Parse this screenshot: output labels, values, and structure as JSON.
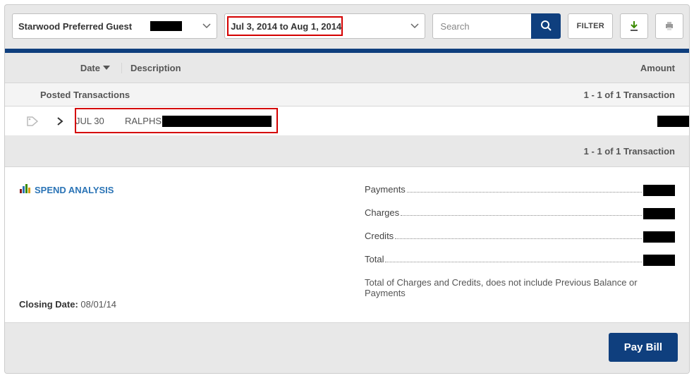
{
  "toolbar": {
    "account_label": "Starwood Preferred Guest",
    "date_range_label": "Jul 3, 2014 to Aug 1, 2014",
    "search_placeholder": "Search",
    "filter_label": "FILTER"
  },
  "headers": {
    "date": "Date",
    "description": "Description",
    "amount": "Amount"
  },
  "subheader": {
    "label": "Posted Transactions",
    "count": "1 - 1 of 1 Transaction"
  },
  "row": {
    "date": "JUL 30",
    "description": "RALPHS"
  },
  "footer_count": "1 - 1 of 1 Transaction",
  "spend_analysis": "SPEND ANALYSIS",
  "summary": {
    "payments": "Payments",
    "charges": "Charges",
    "credits": "Credits",
    "total": "Total",
    "note": "Total of Charges and Credits, does not include Previous Balance or Payments"
  },
  "closing": {
    "label": "Closing Date:",
    "value": "08/01/14"
  },
  "pay_label": "Pay Bill"
}
